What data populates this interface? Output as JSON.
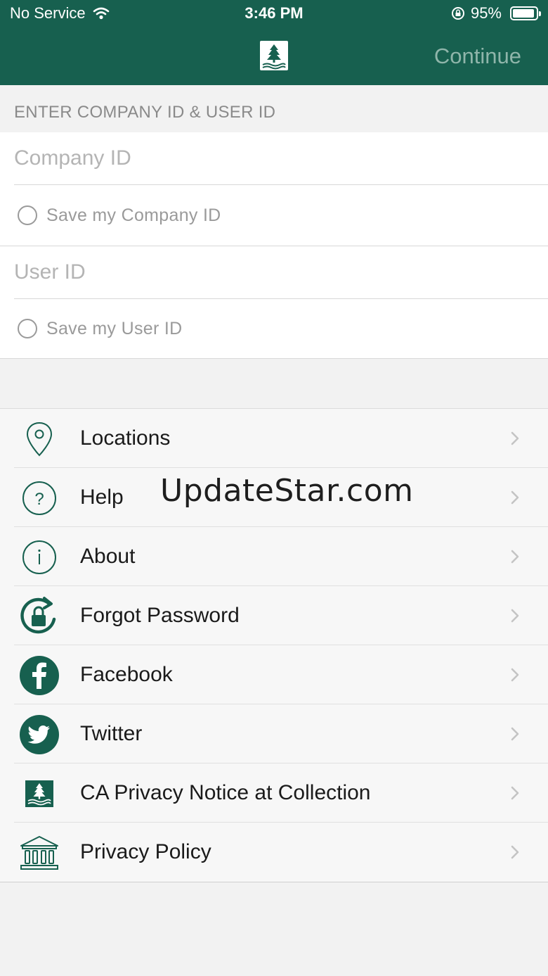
{
  "status_bar": {
    "carrier": "No Service",
    "time": "3:46 PM",
    "battery": "95%"
  },
  "nav": {
    "continue_label": "Continue",
    "logo_icon": "tree-logo-icon"
  },
  "login": {
    "section_header": "ENTER COMPANY ID & USER ID",
    "company_id_placeholder": "Company ID",
    "company_id_value": "",
    "save_company_label": "Save my Company ID",
    "user_id_placeholder": "User ID",
    "user_id_value": "",
    "save_user_label": "Save my User ID"
  },
  "menu": {
    "items": [
      {
        "label": "Locations",
        "icon": "location-pin-icon"
      },
      {
        "label": "Help",
        "icon": "help-icon"
      },
      {
        "label": "About",
        "icon": "info-icon"
      },
      {
        "label": "Forgot Password",
        "icon": "lock-reset-icon"
      },
      {
        "label": "Facebook",
        "icon": "facebook-icon"
      },
      {
        "label": "Twitter",
        "icon": "twitter-icon"
      },
      {
        "label": "CA Privacy Notice at Collection",
        "icon": "tree-logo-icon"
      },
      {
        "label": "Privacy Policy",
        "icon": "bank-icon"
      }
    ]
  },
  "watermark": "UpdateStar.com",
  "colors": {
    "brand_green": "#17604f",
    "continue_disabled": "#8fb5aa",
    "background": "#f2f2f2"
  }
}
